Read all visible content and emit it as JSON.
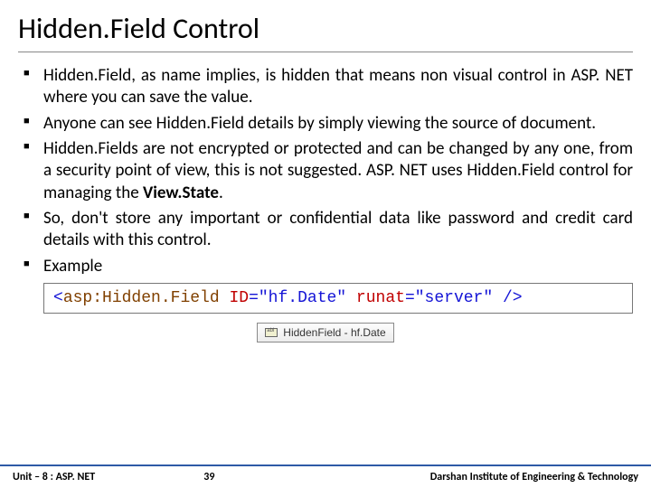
{
  "title": "Hidden.Field Control",
  "bullets": [
    {
      "text_pre": "Hidden.Field, as name implies, is hidden that means non visual control in ASP. NET where you can save the value.",
      "bold": "",
      "text_post": ""
    },
    {
      "text_pre": "Anyone can see Hidden.Field details by simply viewing the source of document.",
      "bold": "",
      "text_post": ""
    },
    {
      "text_pre": "Hidden.Fields are not encrypted or protected and can be changed by any one, from a security point of view, this is not suggested. ASP. NET uses Hidden.Field control for managing the ",
      "bold": "View.State",
      "text_post": "."
    },
    {
      "text_pre": "So, don't store any important or confidential data like password and credit card details with this control.",
      "bold": "",
      "text_post": ""
    },
    {
      "text_pre": "Example",
      "bold": "",
      "text_post": ""
    }
  ],
  "code": {
    "open": "<",
    "tag": "asp:",
    "el": "Hidden.Field",
    "sp1": " ",
    "attr1": "ID",
    "eq1": "=\"hf.Date\"",
    "sp2": " ",
    "attr2": "runat",
    "eq2": "=\"server\"",
    "close": " />"
  },
  "badge": "HiddenField - hf.Date",
  "footer": {
    "left": "Unit – 8 : ASP. NET",
    "center": "39",
    "right": "Darshan Institute of Engineering & Technology"
  }
}
